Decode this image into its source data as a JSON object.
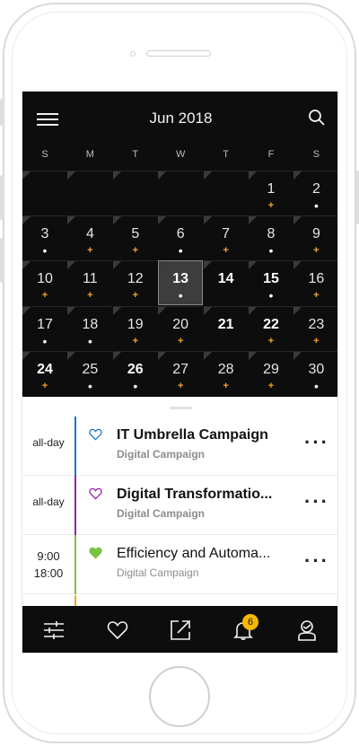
{
  "header": {
    "month_title": "Jun 2018",
    "menu_icon": "hamburger-menu-icon",
    "search_icon": "search-icon"
  },
  "weekdays": [
    "S",
    "M",
    "T",
    "W",
    "T",
    "F",
    "S"
  ],
  "calendar": {
    "weeks": [
      [
        null,
        null,
        null,
        null,
        null,
        {
          "day": "1",
          "mark": "plus"
        },
        {
          "day": "2",
          "mark": "dot"
        }
      ],
      [
        {
          "day": "3",
          "mark": "dot"
        },
        {
          "day": "4",
          "mark": "plus"
        },
        {
          "day": "5",
          "mark": "plus"
        },
        {
          "day": "6",
          "mark": "dot"
        },
        {
          "day": "7",
          "mark": "plus"
        },
        {
          "day": "8",
          "mark": "dot"
        },
        {
          "day": "9",
          "mark": "plus"
        }
      ],
      [
        {
          "day": "10",
          "mark": "plus"
        },
        {
          "day": "11",
          "mark": "plus"
        },
        {
          "day": "12",
          "mark": "plus"
        },
        {
          "day": "13",
          "mark": "dot",
          "bold": true,
          "selected": true
        },
        {
          "day": "14",
          "bold": true
        },
        {
          "day": "15",
          "mark": "dot",
          "bold": true
        },
        {
          "day": "16",
          "mark": "plus"
        }
      ],
      [
        {
          "day": "17",
          "mark": "dot"
        },
        {
          "day": "18",
          "mark": "dot"
        },
        {
          "day": "19",
          "mark": "plus"
        },
        {
          "day": "20",
          "mark": "plus"
        },
        {
          "day": "21",
          "bold": true
        },
        {
          "day": "22",
          "mark": "plus",
          "bold": true
        },
        {
          "day": "23",
          "mark": "plus"
        }
      ],
      [
        {
          "day": "24",
          "mark": "plus",
          "bold": true
        },
        {
          "day": "25",
          "mark": "dot"
        },
        {
          "day": "26",
          "mark": "dot",
          "bold": true
        },
        {
          "day": "27",
          "mark": "plus"
        },
        {
          "day": "28",
          "mark": "plus"
        },
        {
          "day": "29",
          "mark": "plus"
        },
        {
          "day": "30",
          "mark": "dot"
        }
      ]
    ]
  },
  "events": [
    {
      "time_start": "all-day",
      "time_end": "",
      "title": "IT Umbrella Campaign",
      "subtitle": "Digital Campaign",
      "bar_color": "#1a73c9",
      "heart_color": "#1a73c9",
      "heart_filled": false,
      "title_bold": true,
      "subtitle_bold": true,
      "more": "⋮"
    },
    {
      "time_start": "all-day",
      "time_end": "",
      "title": "Digital Transformatio...",
      "subtitle": "Digital Campaign",
      "bar_color": "#8e24aa",
      "heart_color": "#8e24aa",
      "heart_filled": false,
      "title_bold": true,
      "subtitle_bold": true,
      "more": "⋮"
    },
    {
      "time_start": "9:00",
      "time_end": "18:00",
      "title": "Efficiency and Automa...",
      "subtitle": "Digital Campaign",
      "bar_color": "#7cc142",
      "heart_color": "#7cc142",
      "heart_filled": true,
      "title_bold": false,
      "subtitle_bold": false,
      "more": "⋮"
    }
  ],
  "bottom_nav": {
    "items": [
      "filters-icon",
      "favorites-heart-icon",
      "share-export-icon",
      "notifications-bell-icon",
      "profile-icon"
    ],
    "notification_count": "6"
  },
  "colors": {
    "calendar_bg": "#0d0d0d",
    "accent_plus": "#f5a623",
    "badge": "#f5b800"
  }
}
